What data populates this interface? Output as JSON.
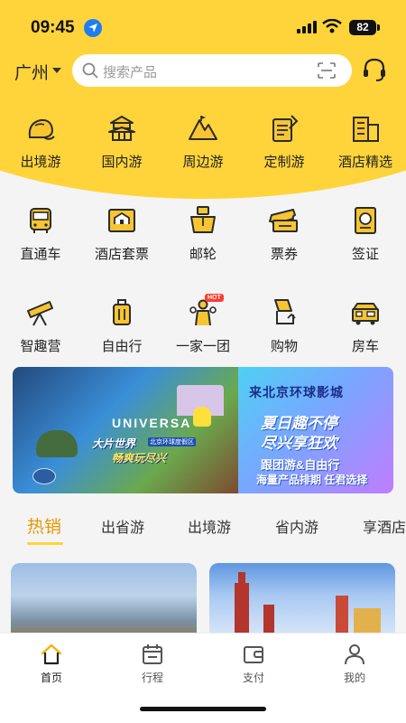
{
  "status_bar": {
    "time": "09:45",
    "battery": "82"
  },
  "header": {
    "city": "广州",
    "search_placeholder": "搜索产品"
  },
  "categories_row1": [
    {
      "label": "出境游",
      "icon": "outbound-icon"
    },
    {
      "label": "国内游",
      "icon": "temple-icon"
    },
    {
      "label": "周边游",
      "icon": "mountain-icon"
    },
    {
      "label": "定制游",
      "icon": "custom-icon"
    },
    {
      "label": "酒店精选",
      "icon": "hotel-icon"
    }
  ],
  "categories_row2": [
    {
      "label": "直通车",
      "icon": "bus-icon"
    },
    {
      "label": "酒店套票",
      "icon": "hotel-package-icon"
    },
    {
      "label": "邮轮",
      "icon": "cruise-icon"
    },
    {
      "label": "票券",
      "icon": "ticket-icon"
    },
    {
      "label": "签证",
      "icon": "passport-icon"
    }
  ],
  "categories_row3": [
    {
      "label": "智趣营",
      "icon": "telescope-icon"
    },
    {
      "label": "自由行",
      "icon": "luggage-icon"
    },
    {
      "label": "一家一团",
      "icon": "family-icon",
      "tag": "HOT"
    },
    {
      "label": "购物",
      "icon": "shopping-icon"
    },
    {
      "label": "房车",
      "icon": "rv-icon"
    }
  ],
  "banner": {
    "left_brand": "UNIVERSA",
    "left_line1": "大片世界",
    "left_line2": "畅爽玩尽兴",
    "left_sub": "北京环球度假区",
    "title": "来北京环球影城",
    "line1": "夏日趣不停",
    "line2": "尽兴享狂欢",
    "line3": "跟团游&自由行",
    "line4": "海量产品排期 任君选择"
  },
  "tabs": [
    "热销",
    "出省游",
    "出境游",
    "省内游",
    "享酒店"
  ],
  "tabbar": [
    {
      "label": "首页",
      "icon": "home-icon"
    },
    {
      "label": "行程",
      "icon": "calendar-icon"
    },
    {
      "label": "支付",
      "icon": "wallet-icon"
    },
    {
      "label": "我的",
      "icon": "profile-icon"
    }
  ],
  "colors": {
    "brand_yellow": "#ffd43a",
    "active_tab": "#e69a00",
    "icon_yellow": "#f7c531",
    "icon_stroke": "#2b2b2b"
  }
}
